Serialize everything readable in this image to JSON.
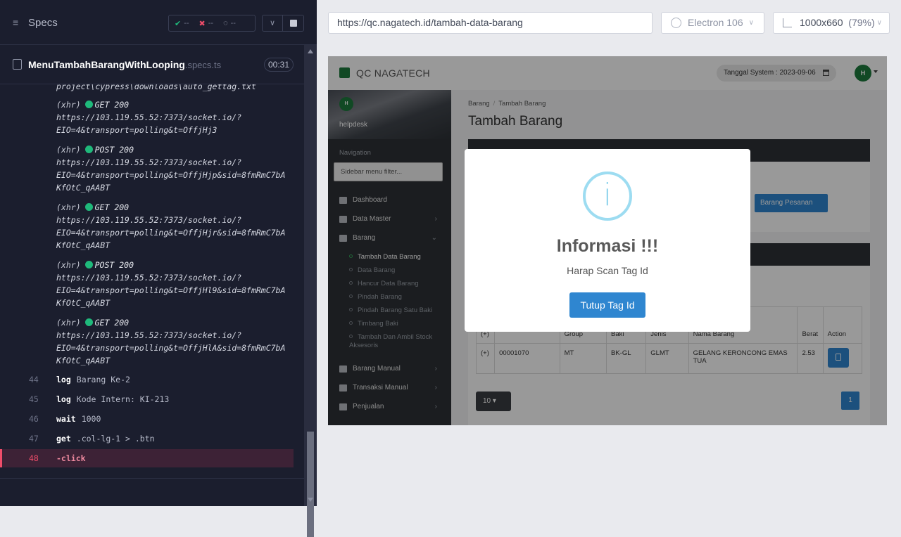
{
  "runner": {
    "specs_label": "Specs",
    "stats": {
      "passed": "--",
      "failed": "--",
      "pending": "--"
    },
    "spec_file": "MenuTambahBarangWithLooping",
    "spec_ext": ".specs.ts",
    "duration": "00:31",
    "cut_line": "project\\cypress\\downloads\\auto_gettag.txt",
    "requests": [
      {
        "kind": "(xhr)",
        "method": "GET 200",
        "url1": "https://103.119.55.52:7373/socket.io/?",
        "url2": "EIO=4&transport=polling&t=OffjHj3",
        "url3": ""
      },
      {
        "kind": "(xhr)",
        "method": "POST 200",
        "url1": "https://103.119.55.52:7373/socket.io/?",
        "url2": "EIO=4&transport=polling&t=OffjHjp&sid=8fmRmC7bA",
        "url3": "KfOtC_qAABT"
      },
      {
        "kind": "(xhr)",
        "method": "GET 200",
        "url1": "https://103.119.55.52:7373/socket.io/?",
        "url2": "EIO=4&transport=polling&t=OffjHjr&sid=8fmRmC7bA",
        "url3": "KfOtC_qAABT"
      },
      {
        "kind": "(xhr)",
        "method": "POST 200",
        "url1": "https://103.119.55.52:7373/socket.io/?",
        "url2": "EIO=4&transport=polling&t=OffjHl9&sid=8fmRmC7bA",
        "url3": "KfOtC_qAABT"
      },
      {
        "kind": "(xhr)",
        "method": "GET 200",
        "url1": "https://103.119.55.52:7373/socket.io/?",
        "url2": "EIO=4&transport=polling&t=OffjHlA&sid=8fmRmC7bA",
        "url3": "KfOtC_qAABT"
      }
    ],
    "commands": [
      {
        "num": "44",
        "name": "log",
        "arg": "Barang Ke-2"
      },
      {
        "num": "45",
        "name": "log",
        "arg": "Kode Intern: KI-213"
      },
      {
        "num": "46",
        "name": "wait",
        "arg": "1000"
      },
      {
        "num": "47",
        "name": "get",
        "arg": ".col-lg-1 > .btn"
      },
      {
        "num": "48",
        "name": "-click",
        "arg": ""
      }
    ]
  },
  "browser": {
    "url": "https://qc.nagatech.id/tambah-data-barang",
    "name": "Electron 106",
    "viewport": "1000x660",
    "zoom": "(79%)"
  },
  "app": {
    "title": "QC NAGATECH",
    "system_date": "Tanggal System : 2023-09-06",
    "avatar": "H",
    "user": "helpdesk",
    "nav_label": "Navigation",
    "filter_placeholder": "Sidebar menu filter...",
    "menu": {
      "dashboard": "Dashboard",
      "data_master": "Data Master",
      "barang": "Barang",
      "barang_manual": "Barang Manual",
      "transaksi_manual": "Transaksi Manual",
      "penjualan": "Penjualan"
    },
    "submenu": [
      "Tambah Data Barang",
      "Data Barang",
      "Hancur Data Barang",
      "Pindah Barang",
      "Pindah Barang Satu Baki",
      "Timbang Baki",
      "Tambah Dan Ambil Stock Aksesoris"
    ],
    "breadcrumb": {
      "root": "Barang",
      "current": "Tambah Barang"
    },
    "page_title": "Tambah Barang",
    "pesanan_button": "Barang Pesanan",
    "table": {
      "headers": [
        "(+)",
        "",
        "Group",
        "Baki",
        "Jenis",
        "Nama Barang",
        "Berat",
        "Action"
      ],
      "rows": [
        {
          "plus": "(+)",
          "kode": "00001070",
          "group": "MT",
          "baki": "BK-GL",
          "jenis": "GLMT",
          "nama": "GELANG KERONCONG EMAS TUA",
          "berat": "2.53"
        }
      ]
    },
    "page_size": "10",
    "page_number": "1"
  },
  "modal": {
    "icon": "i",
    "title": "Informasi !!!",
    "text": "Harap Scan Tag Id",
    "button": "Tutup Tag Id"
  }
}
